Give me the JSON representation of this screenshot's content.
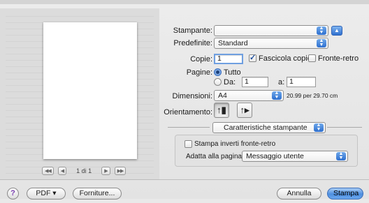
{
  "printer": {
    "label": "Stampante:",
    "value": ""
  },
  "presets": {
    "label": "Predefinite:",
    "value": "Standard"
  },
  "copies": {
    "label": "Copie:",
    "value": "1",
    "collate_label": "Fascicola copie",
    "collate_checked": true,
    "duplex_label": "Fronte-retro",
    "duplex_checked": false
  },
  "pages": {
    "label": "Pagine:",
    "all_label": "Tutto",
    "from_label": "Da:",
    "from_value": "1",
    "to_label": "a:",
    "to_value": "1"
  },
  "size": {
    "label": "Dimensioni:",
    "value": "A4",
    "dims": "20.99 per 29.70 cm"
  },
  "orientation": {
    "label": "Orientamento:"
  },
  "panel": {
    "value": "Caratteristiche stampante"
  },
  "features": {
    "reverse_label": "Stampa inverti fronte-retro",
    "fit_label": "Adatta alla pagina:",
    "fit_value": "Messaggio utente"
  },
  "preview": {
    "page_text": "1 di 1"
  },
  "footer": {
    "help": "?",
    "pdf": "PDF ▾",
    "supplies": "Forniture...",
    "cancel": "Annulla",
    "print": "Stampa"
  }
}
